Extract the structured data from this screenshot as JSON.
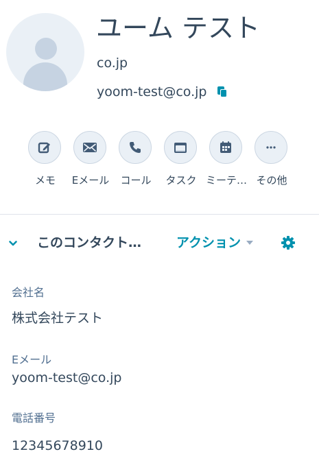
{
  "contact": {
    "name": "ユーム テスト",
    "domain": "co.jp",
    "email": "yoom-test@co.jp"
  },
  "actions": [
    {
      "label": "メモ",
      "icon": "note-edit-icon"
    },
    {
      "label": "Eメール",
      "icon": "envelope-icon"
    },
    {
      "label": "コール",
      "icon": "phone-icon"
    },
    {
      "label": "タスク",
      "icon": "task-icon"
    },
    {
      "label": "ミーテ…",
      "icon": "calendar-icon"
    },
    {
      "label": "その他",
      "icon": "more-icon"
    }
  ],
  "section": {
    "title": "このコンタクト…",
    "action_label": "アクション"
  },
  "properties": [
    {
      "label": "会社名",
      "value": "株式会社テスト"
    },
    {
      "label": "Eメール",
      "value": "yoom-test@co.jp"
    },
    {
      "label": "電話番号",
      "value": "12345678910"
    }
  ],
  "colors": {
    "accent": "#0091ae",
    "icon": "#425b76",
    "circle_bg": "#eaf0f6",
    "text": "#33475b",
    "label": "#516f90"
  }
}
